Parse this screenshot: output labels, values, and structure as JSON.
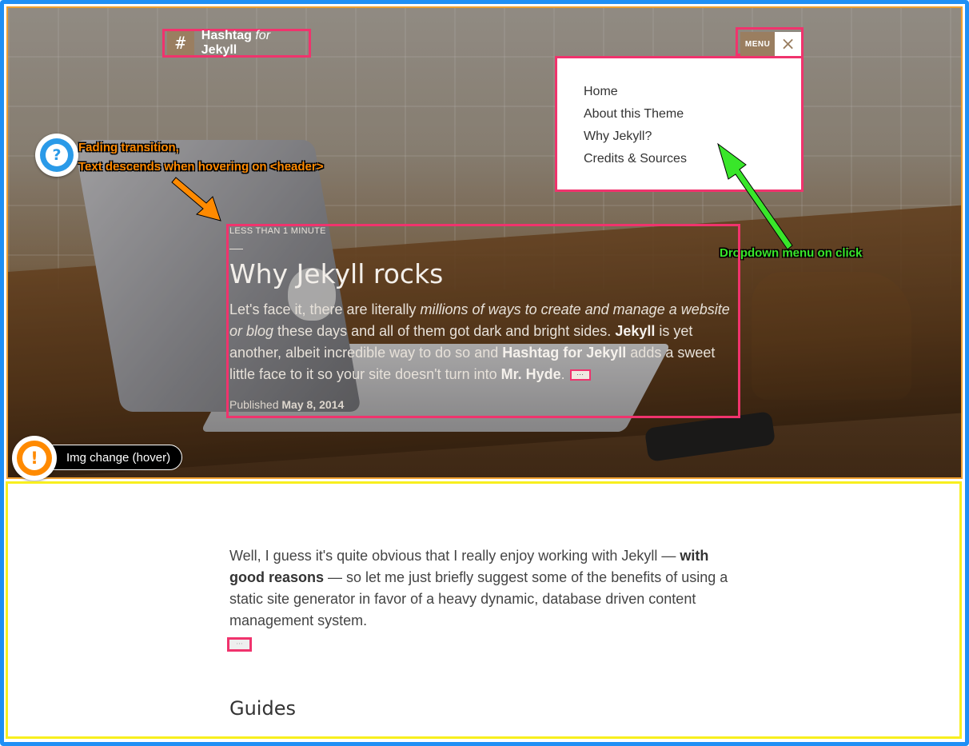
{
  "header": {
    "logo_symbol": "#",
    "logo_name": "Hashtag",
    "logo_for": "for",
    "logo_jekyll": "Jekyll",
    "menu_label": "MENU",
    "close_symbol": "×"
  },
  "menu": {
    "items": [
      {
        "label": "Home"
      },
      {
        "label": "About this Theme"
      },
      {
        "label": "Why Jekyll?"
      },
      {
        "label": "Credits & Sources"
      }
    ]
  },
  "annotations": {
    "help_symbol": "?",
    "fading_line1": "Fading transition,",
    "fading_line2": "Text descends when hovering on  <header>",
    "dropdown_note": "Dropdown menu on click",
    "warn_symbol": "!",
    "img_change": "Img change (hover)"
  },
  "post": {
    "reading_time": "LESS THAN 1 MINUTE",
    "title": "Why Jekyll rocks",
    "excerpt_1": "Let's face it, there are literally ",
    "excerpt_em": "millions of ways to create and manage a website or blog",
    "excerpt_2": " these days and all of them got dark and bright sides. ",
    "excerpt_b1": "Jekyll",
    "excerpt_3": " is yet another, albeit incredible way to do so and ",
    "excerpt_b2": "Hashtag for Jekyll",
    "excerpt_4": " adds a sweet little face to it so your site doesn't turn into ",
    "excerpt_b3": "Mr. Hyde",
    "excerpt_5": ".",
    "more_symbol": "···",
    "published_label": "Published",
    "published_date": "May 8, 2014"
  },
  "content": {
    "para_1": "Well, I guess it's quite obvious that I really enjoy working with Jekyll — ",
    "para_b": "with good reasons",
    "para_2": " — so let me just briefly suggest some of the benefits of using a static site generator in favor of a heavy dynamic, database driven content management system.",
    "more_symbol": "···",
    "guides_heading": "Guides"
  },
  "colors": {
    "frame_blue": "#1f8ff5",
    "hero_border_orange": "#f0a030",
    "highlight_pink": "#f0336d",
    "content_border_yellow": "#f8ef1e",
    "annotation_orange": "#ff8a00",
    "annotation_green": "#39e62a",
    "logo_brown": "#9a7e60"
  },
  "icons": {
    "logo": "hashtag-icon",
    "close": "close-icon",
    "help": "question-icon",
    "warn": "exclamation-icon"
  }
}
